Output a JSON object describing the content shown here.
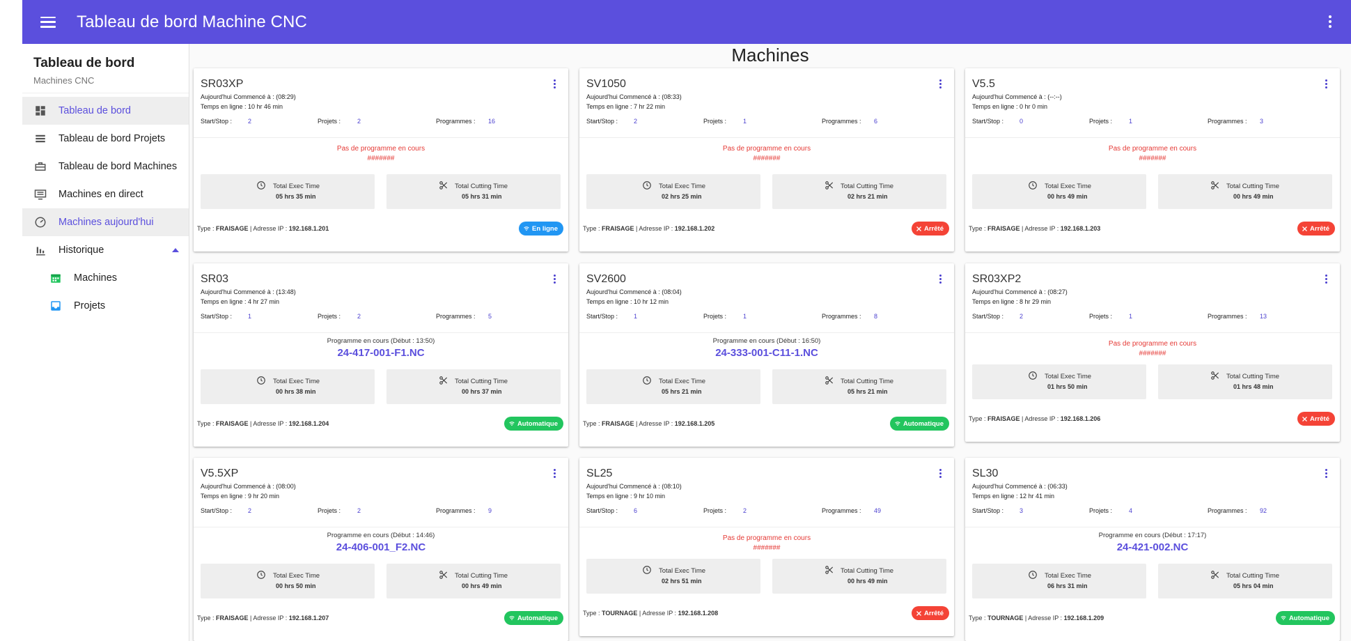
{
  "header": {
    "title": "Tableau de bord Machine CNC"
  },
  "sidebar": {
    "title": "Tableau de bord",
    "subtitle": "Machines CNC",
    "items": [
      {
        "label": "Tableau de bord",
        "icon": "dashboard-icon"
      },
      {
        "label": "Tableau de bord Projets",
        "icon": "list-icon"
      },
      {
        "label": "Tableau de bord Machines",
        "icon": "briefcase-icon"
      },
      {
        "label": "Machines en direct",
        "icon": "monitor-icon"
      },
      {
        "label": "Machines aujourd'hui",
        "icon": "speed-icon"
      },
      {
        "label": "Historique",
        "icon": "bar-chart-icon"
      }
    ],
    "subitems": [
      {
        "label": "Machines",
        "icon": "calendar-icon"
      },
      {
        "label": "Projets",
        "icon": "inbox-icon"
      }
    ]
  },
  "main": {
    "title": "Machines"
  },
  "labels": {
    "started": "Aujourd'hui Commencé à :",
    "online": "Temps en ligne :",
    "startstop": "Start/Stop :",
    "projects": "Projets :",
    "programs": "Programmes :",
    "no_program": "Pas de programme en cours",
    "no_program_code": "#######",
    "exec": "Total Exec Time",
    "cutting": "Total Cutting Time",
    "type": "Type :",
    "ip": "Adresse IP :",
    "program_running": "Programme en cours (Début : "
  },
  "machines": [
    {
      "name": "SR03XP",
      "start": "(08:29)",
      "online": "10 hr 46 min",
      "startstop": "2",
      "projects": "2",
      "programs": "16",
      "program": null,
      "exec": "05 hrs 35 min",
      "cutting": "05 hrs 31 min",
      "type": "FRAISAGE",
      "ip": "192.168.1.201",
      "status": "En ligne",
      "status_kind": "online"
    },
    {
      "name": "SV1050",
      "start": "(08:33)",
      "online": "7 hr 22 min",
      "startstop": "2",
      "projects": "1",
      "programs": "6",
      "program": null,
      "exec": "02 hrs 25 min",
      "cutting": "02 hrs 21 min",
      "type": "FRAISAGE",
      "ip": "192.168.1.202",
      "status": "Arrêté",
      "status_kind": "stop"
    },
    {
      "name": "V5.5",
      "start": "(--:--)",
      "online": "0 hr 0 min",
      "startstop": "0",
      "projects": "1",
      "programs": "3",
      "program": null,
      "exec": "00 hrs 49 min",
      "cutting": "00 hrs 49 min",
      "type": "FRAISAGE",
      "ip": "192.168.1.203",
      "status": "Arrêté",
      "status_kind": "stop"
    },
    {
      "name": "SR03",
      "start": "(13:48)",
      "online": "4 hr 27 min",
      "startstop": "1",
      "projects": "2",
      "programs": "5",
      "program": {
        "start": "13:50",
        "file": "24-417-001-F1.NC"
      },
      "exec": "00 hrs 38 min",
      "cutting": "00 hrs 37 min",
      "type": "FRAISAGE",
      "ip": "192.168.1.204",
      "status": "Automatique",
      "status_kind": "auto"
    },
    {
      "name": "SV2600",
      "start": "(08:04)",
      "online": "10 hr 12 min",
      "startstop": "1",
      "projects": "1",
      "programs": "8",
      "program": {
        "start": "16:50",
        "file": "24-333-001-C11-1.NC"
      },
      "exec": "05 hrs 21 min",
      "cutting": "05 hrs 21 min",
      "type": "FRAISAGE",
      "ip": "192.168.1.205",
      "status": "Automatique",
      "status_kind": "auto"
    },
    {
      "name": "SR03XP2",
      "start": "(08:27)",
      "online": "8 hr 29 min",
      "startstop": "2",
      "projects": "1",
      "programs": "13",
      "program": null,
      "exec": "01 hrs 50 min",
      "cutting": "01 hrs 48 min",
      "type": "FRAISAGE",
      "ip": "192.168.1.206",
      "status": "Arrêté",
      "status_kind": "stop"
    },
    {
      "name": "V5.5XP",
      "start": "(08:00)",
      "online": "9 hr 20 min",
      "startstop": "2",
      "projects": "2",
      "programs": "9",
      "program": {
        "start": "14:46",
        "file": "24-406-001_F2.NC"
      },
      "exec": "00 hrs 50 min",
      "cutting": "00 hrs 49 min",
      "type": "FRAISAGE",
      "ip": "192.168.1.207",
      "status": "Automatique",
      "status_kind": "auto"
    },
    {
      "name": "SL25",
      "start": "(08:10)",
      "online": "9 hr 10 min",
      "startstop": "6",
      "projects": "2",
      "programs": "49",
      "program": null,
      "exec": "02 hrs 51 min",
      "cutting": "00 hrs 49 min",
      "type": "TOURNAGE",
      "ip": "192.168.1.208",
      "status": "Arrêté",
      "status_kind": "stop"
    },
    {
      "name": "SL30",
      "start": "(06:33)",
      "online": "12 hr 41 min",
      "startstop": "3",
      "projects": "4",
      "programs": "92",
      "program": {
        "start": "17:17",
        "file": "24-421-002.NC"
      },
      "exec": "06 hrs 31 min",
      "cutting": "05 hrs 04 min",
      "type": "TOURNAGE",
      "ip": "192.168.1.209",
      "status": "Automatique",
      "status_kind": "auto"
    }
  ],
  "colors": {
    "primary": "#5b4fdd",
    "online": "#2196f3",
    "stop": "#f44336",
    "auto": "#22c55e",
    "error_text": "#e53935"
  }
}
